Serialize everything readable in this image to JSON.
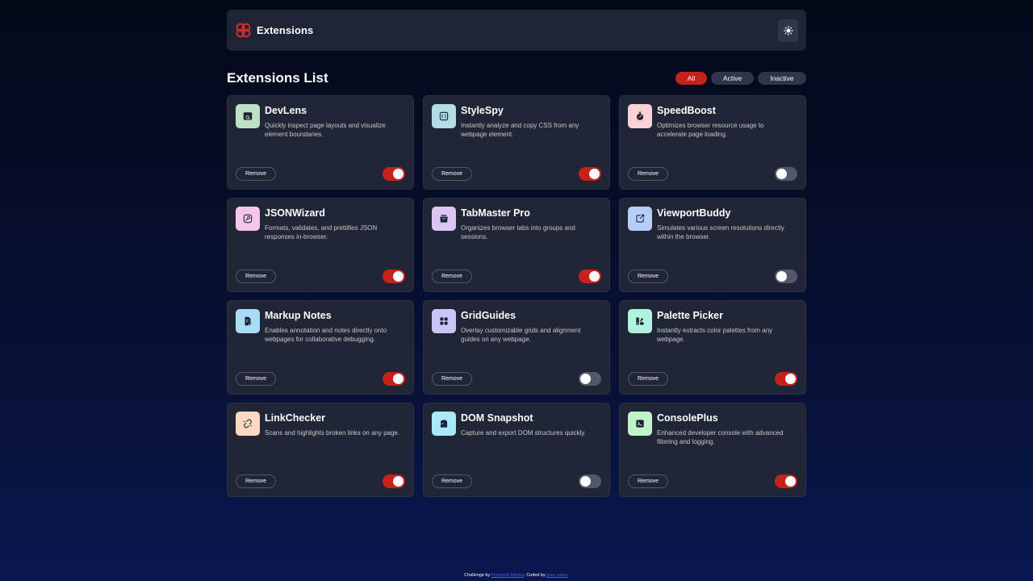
{
  "header": {
    "brand_name": "Extensions",
    "theme_icon": "sun-icon"
  },
  "list": {
    "title": "Extensions List",
    "filters": [
      {
        "label": "All",
        "active": true
      },
      {
        "label": "Active",
        "active": false
      },
      {
        "label": "Inactive",
        "active": false
      }
    ]
  },
  "colors": {
    "accent": "#c7221a",
    "card_bg": "#212636",
    "toggle_off": "#535868"
  },
  "extensions": [
    {
      "name": "DevLens",
      "description": "Quickly inspect page layouts and visualize element boundaries.",
      "icon": "devlens-icon",
      "icon_bg": "#bde0c6",
      "remove_label": "Remove",
      "enabled": true
    },
    {
      "name": "StyleSpy",
      "description": "Instantly analyze and copy CSS from any webpage element.",
      "icon": "stylespy-icon",
      "icon_bg": "#b3dbe8",
      "remove_label": "Remove",
      "enabled": true
    },
    {
      "name": "SpeedBoost",
      "description": "Optimizes browser resource usage to accelerate page loading.",
      "icon": "speedboost-icon",
      "icon_bg": "#fbd1d3",
      "remove_label": "Remove",
      "enabled": false
    },
    {
      "name": "JSONWizard",
      "description": "Formats, validates, and prettifies JSON responses in-browser.",
      "icon": "jsonwizard-icon",
      "icon_bg": "#f4c6ea",
      "remove_label": "Remove",
      "enabled": true
    },
    {
      "name": "TabMaster Pro",
      "description": "Organizes browser tabs into groups and sessions.",
      "icon": "tabmaster-icon",
      "icon_bg": "#d9c6f2",
      "remove_label": "Remove",
      "enabled": true
    },
    {
      "name": "ViewportBuddy",
      "description": "Simulates various screen resolutions directly within the browser.",
      "icon": "viewportbuddy-icon",
      "icon_bg": "#b6cdf8",
      "remove_label": "Remove",
      "enabled": false
    },
    {
      "name": "Markup Notes",
      "description": "Enables annotation and notes directly onto webpages for collaborative debugging.",
      "icon": "markupnotes-icon",
      "icon_bg": "#a9dcf7",
      "remove_label": "Remove",
      "enabled": true
    },
    {
      "name": "GridGuides",
      "description": "Overlay customizable grids and alignment guides on any webpage.",
      "icon": "gridguides-icon",
      "icon_bg": "#c8c6f9",
      "remove_label": "Remove",
      "enabled": false
    },
    {
      "name": "Palette Picker",
      "description": "Instantly extracts color palettes from any webpage.",
      "icon": "palettepicker-icon",
      "icon_bg": "#aff2de",
      "remove_label": "Remove",
      "enabled": true
    },
    {
      "name": "LinkChecker",
      "description": "Scans and highlights broken links on any page.",
      "icon": "linkchecker-icon",
      "icon_bg": "#fcd8c3",
      "remove_label": "Remove",
      "enabled": true
    },
    {
      "name": "DOM Snapshot",
      "description": "Capture and export DOM structures quickly.",
      "icon": "domsnapshot-icon",
      "icon_bg": "#a9e9f7",
      "remove_label": "Remove",
      "enabled": false
    },
    {
      "name": "ConsolePlus",
      "description": "Enhanced developer console with advanced filtering and logging.",
      "icon": "consoleplus-icon",
      "icon_bg": "#c1f2c8",
      "remove_label": "Remove",
      "enabled": true
    }
  ],
  "footer": {
    "prefix": "Challenge by ",
    "challenge_link": "Frontend Mentor",
    "middle": ". Coded by ",
    "author_link": "your name",
    "suffix": "."
  }
}
